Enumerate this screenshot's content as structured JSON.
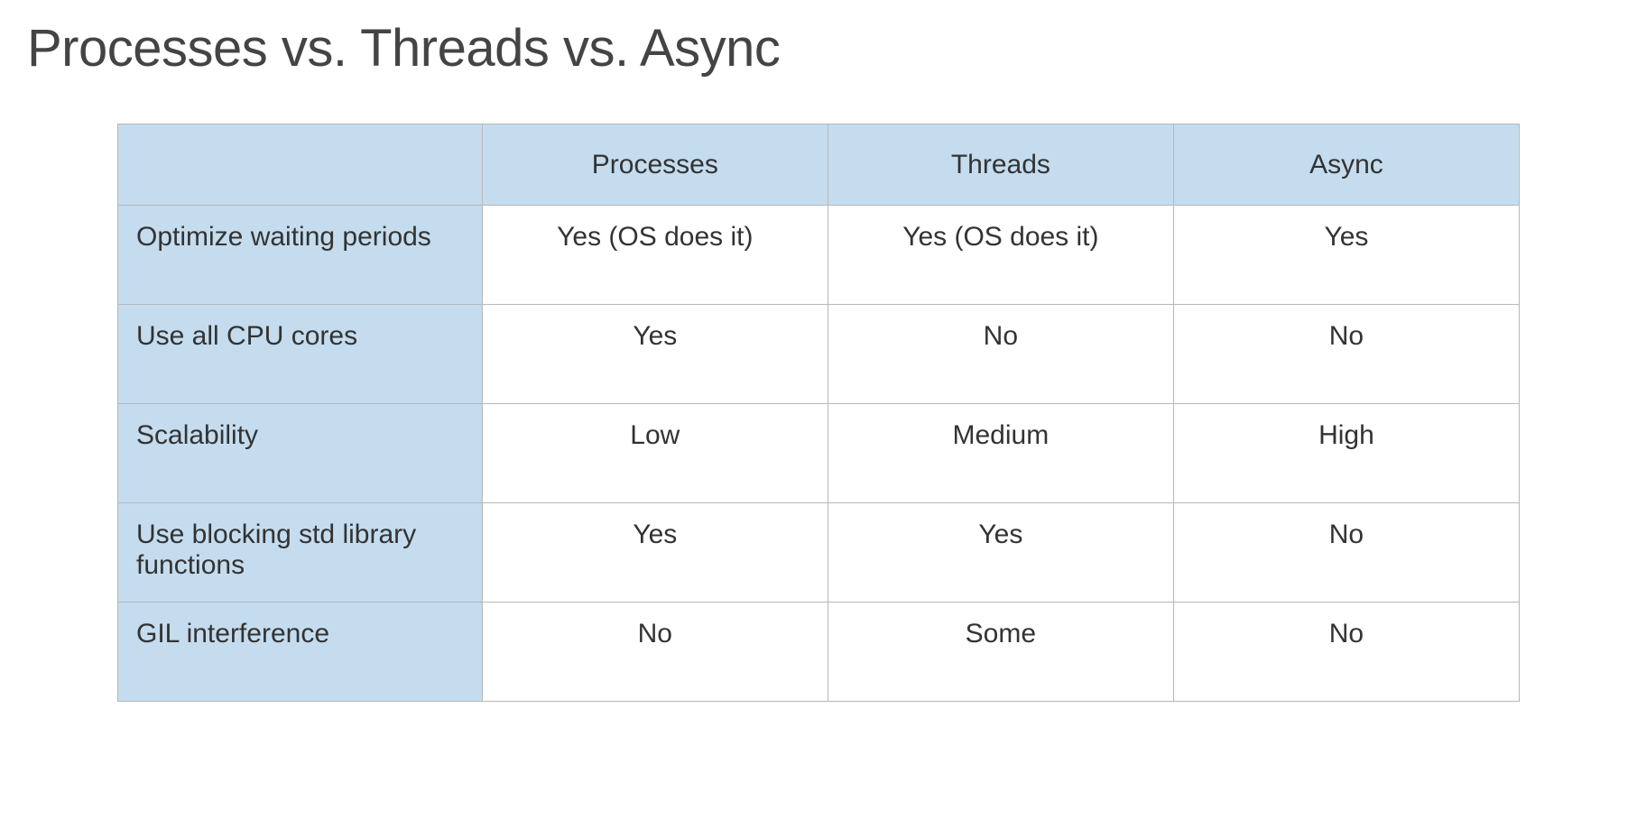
{
  "title": "Processes vs. Threads vs. Async",
  "chart_data": {
    "type": "table",
    "columns": [
      "",
      "Processes",
      "Threads",
      "Async"
    ],
    "rows": [
      {
        "label": "Optimize waiting periods",
        "values": [
          "Yes (OS does it)",
          "Yes (OS does it)",
          "Yes"
        ]
      },
      {
        "label": "Use all CPU cores",
        "values": [
          "Yes",
          "No",
          "No"
        ]
      },
      {
        "label": "Scalability",
        "values": [
          "Low",
          "Medium",
          "High"
        ]
      },
      {
        "label": "Use blocking std library functions",
        "values": [
          "Yes",
          "Yes",
          "No"
        ]
      },
      {
        "label": "GIL interference",
        "values": [
          "No",
          "Some",
          "No"
        ]
      }
    ]
  }
}
